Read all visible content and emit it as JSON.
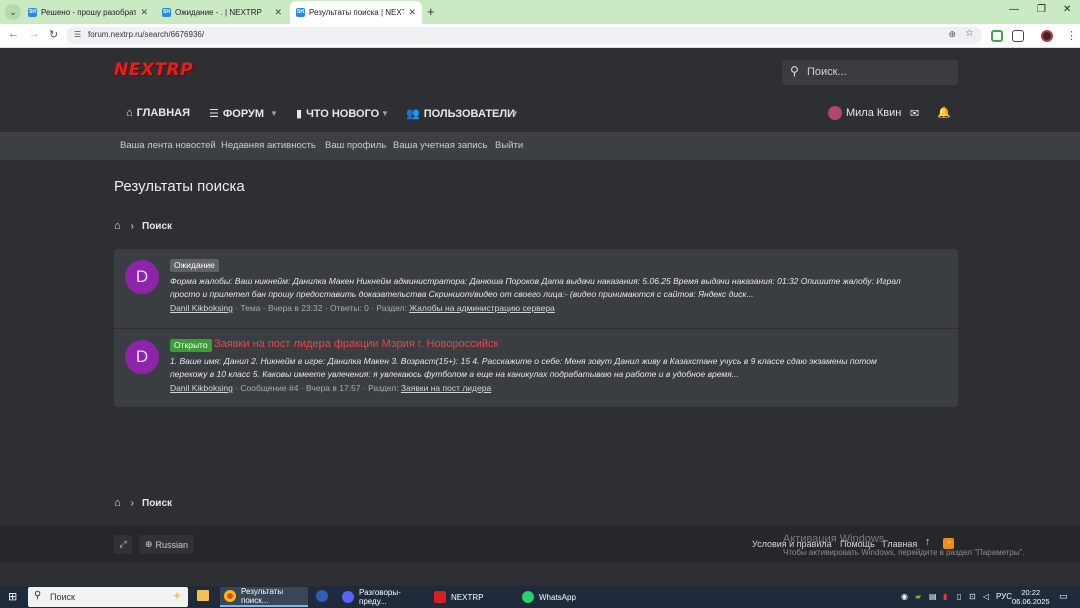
{
  "browser": {
    "tabs": [
      {
        "title": "Решено - прошу разобраться"
      },
      {
        "title": "Ожидание - . | NEXTRP"
      },
      {
        "title": "Результаты поиска | NEXTRP"
      }
    ],
    "favicon_text": "SH",
    "url": "forum.nextrp.ru/search/6676936/"
  },
  "site": {
    "logo": "NEXTRP",
    "search_placeholder": "Поиск...",
    "nav": {
      "home": "ГЛАВНАЯ",
      "forum": "ФОРУМ",
      "whats_new": "ЧТО НОВОГО",
      "users": "ПОЛЬЗОВАТЕЛИ"
    },
    "user_name": "Мила Квин",
    "subnav": [
      "Ваша лента новостей",
      "Недавняя активность",
      "Ваш профиль",
      "Ваша учетная запись",
      "Выйти"
    ]
  },
  "page": {
    "title": "Результаты поиска",
    "breadcrumb": "Поиск"
  },
  "results": [
    {
      "avatar_letter": "D",
      "label": "Ожидание",
      "title": "",
      "snippet_line1": "Форма жалобы: Ваш никнейм: Данилка Макен Никнейм администратора: Данюша Пороков Дата выдачи наказания: 5.06.25 Время выдачи наказания: 01:32 Опишите жалобу: Играл",
      "snippet_line2": "просто и прилетел бан прошу предоставить доказательства Скриншот/видео от своего лица:- (видео принимаются с сайтов: Яндекс диск...",
      "author": "Danil Kikboksing",
      "meta_mid": " · Тема · ",
      "time": "Вчера в 23:32",
      "meta_tail": " · Ответы: 0 · Раздел: ",
      "section": "Жалобы на администрацию сервера"
    },
    {
      "avatar_letter": "D",
      "label": "Открыто",
      "title": "Заявки на пост лидера фракции Мэрия г. Новороссийск",
      "snippet_line1": "1. Ваше имя: Данил 2. Никнейм в игре: Данилка Макен 3. Возраст(15+): 15 4. Расскажите о себе: Меня зовут Данил живу в Казахстане учусь в 9 классе сдаю экзамены потом",
      "snippet_line2": "перехожу в 10 класс 5. Каковы имеете увлечения: я увлекаюсь футболом а еще на каникулах подрабатываю на работе и в удобное время...",
      "author": "Danil Kikboksing",
      "meta_mid": " · Сообщение #4 · ",
      "time": "Вчера в 17:57",
      "meta_tail": " · Раздел: ",
      "section": "Заявки на пост лидера"
    }
  ],
  "footer": {
    "language": "Russian",
    "links": [
      "Условия и правила",
      "Помощь",
      "Главная"
    ],
    "activation_title": "Активация Windows",
    "activation_text": "Чтобы активировать Windows, перейдите в раздел \"Параметры\"."
  },
  "taskbar": {
    "search": "Поиск",
    "apps": [
      "Результаты поиск...",
      "Разговоры-преду...",
      "NEXTRP",
      "WhatsApp"
    ],
    "lang": "РУС",
    "time": "20:22",
    "date": "06.06.2025"
  }
}
